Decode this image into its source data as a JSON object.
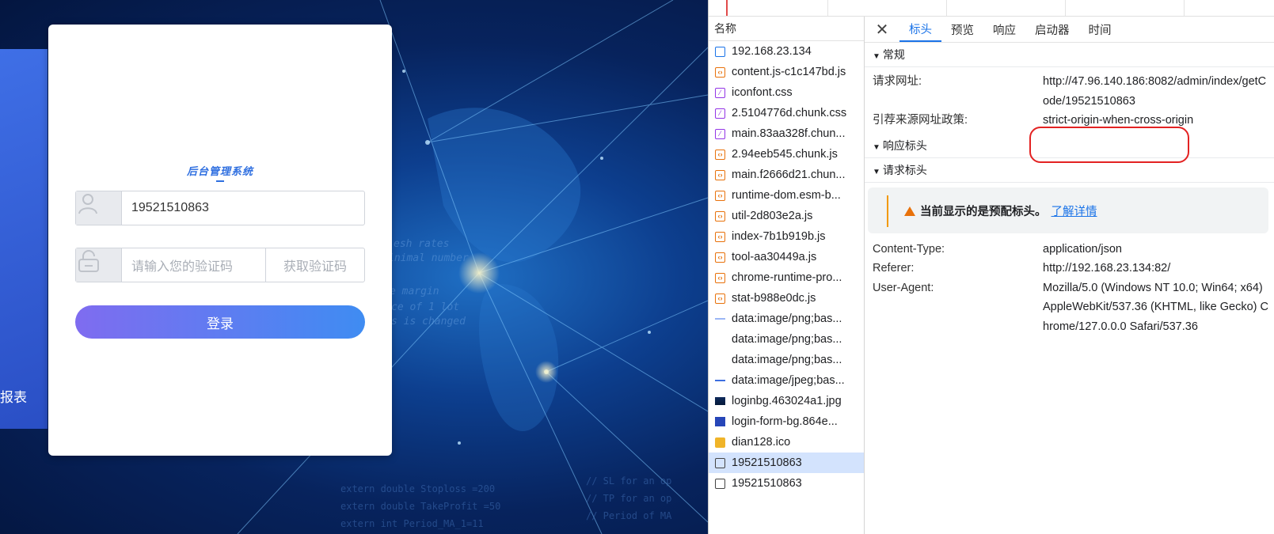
{
  "login": {
    "background_side_text": "报表",
    "logo_title": "后台管理系统",
    "username_value": "19521510863",
    "code_placeholder": "请输入您的验证码",
    "get_code_label": "获取验证码",
    "login_button": "登录",
    "background_code_text": [
      "esh rates",
      "inimal number",
      "e margin",
      "ce of 1 lot",
      "s is changed",
      "extern double Stoploss   =200",
      "extern double TakeProfit =50",
      "extern int    Period_MA_1=11",
      "// SL for an op",
      "// TP for an op",
      "// Period of MA"
    ]
  },
  "devtools": {
    "name_header": "名称",
    "requests": [
      {
        "name": "192.168.23.134",
        "icon": "document-icon"
      },
      {
        "name": "content.js-c1c147bd.js",
        "icon": "script-icon"
      },
      {
        "name": "iconfont.css",
        "icon": "stylesheet-icon"
      },
      {
        "name": "2.5104776d.chunk.css",
        "icon": "stylesheet-icon"
      },
      {
        "name": "main.83aa328f.chun...",
        "icon": "stylesheet-icon"
      },
      {
        "name": "2.94eeb545.chunk.js",
        "icon": "script-icon"
      },
      {
        "name": "main.f2666d21.chun...",
        "icon": "script-icon"
      },
      {
        "name": "runtime-dom.esm-b...",
        "icon": "script-icon"
      },
      {
        "name": "util-2d803e2a.js",
        "icon": "script-icon"
      },
      {
        "name": "index-7b1b919b.js",
        "icon": "script-icon"
      },
      {
        "name": "tool-aa30449a.js",
        "icon": "script-icon"
      },
      {
        "name": "chrome-runtime-pro...",
        "icon": "script-icon"
      },
      {
        "name": "stat-b988e0dc.js",
        "icon": "script-icon"
      },
      {
        "name": "data:image/png;bas...",
        "icon": "image-icon"
      },
      {
        "name": "data:image/png;bas...",
        "icon": "image-icon"
      },
      {
        "name": "data:image/png;bas...",
        "icon": "image-icon"
      },
      {
        "name": "data:image/jpeg;bas...",
        "icon": "image-icon"
      },
      {
        "name": "loginbg.463024a1.jpg",
        "icon": "image-icon"
      },
      {
        "name": "login-form-bg.864e...",
        "icon": "image-icon"
      },
      {
        "name": "dian128.ico",
        "icon": "favicon-icon"
      },
      {
        "name": "19521510863",
        "icon": "fetch-icon"
      },
      {
        "name": "19521510863",
        "icon": "fetch-icon"
      }
    ],
    "tabs": [
      "标头",
      "预览",
      "响应",
      "启动器",
      "时间"
    ],
    "sections": {
      "general": "常规",
      "response_headers": "响应标头",
      "request_headers": "请求标头"
    },
    "general": [
      {
        "key": "请求网址:",
        "value": "http://47.96.140.186:8082/admin/index/getCode/19521510863"
      },
      {
        "key": "引荐来源网址政策:",
        "value": "strict-origin-when-cross-origin"
      }
    ],
    "warning": {
      "text": "当前显示的是预配标头。",
      "link": "了解详情"
    },
    "request_headers": [
      {
        "key": "Content-Type:",
        "value": "application/json"
      },
      {
        "key": "Referer:",
        "value": "http://192.168.23.134:82/"
      },
      {
        "key": "User-Agent:",
        "value": "Mozilla/5.0 (Windows NT 10.0; Win64; x64) AppleWebKit/537.36 (KHTML, like Gecko) Chrome/127.0.0.0 Safari/537.36"
      }
    ],
    "colors": {
      "accent": "#1a73e8",
      "selected_row": "#d3e3fd",
      "highlight_circle": "#e32222"
    }
  }
}
